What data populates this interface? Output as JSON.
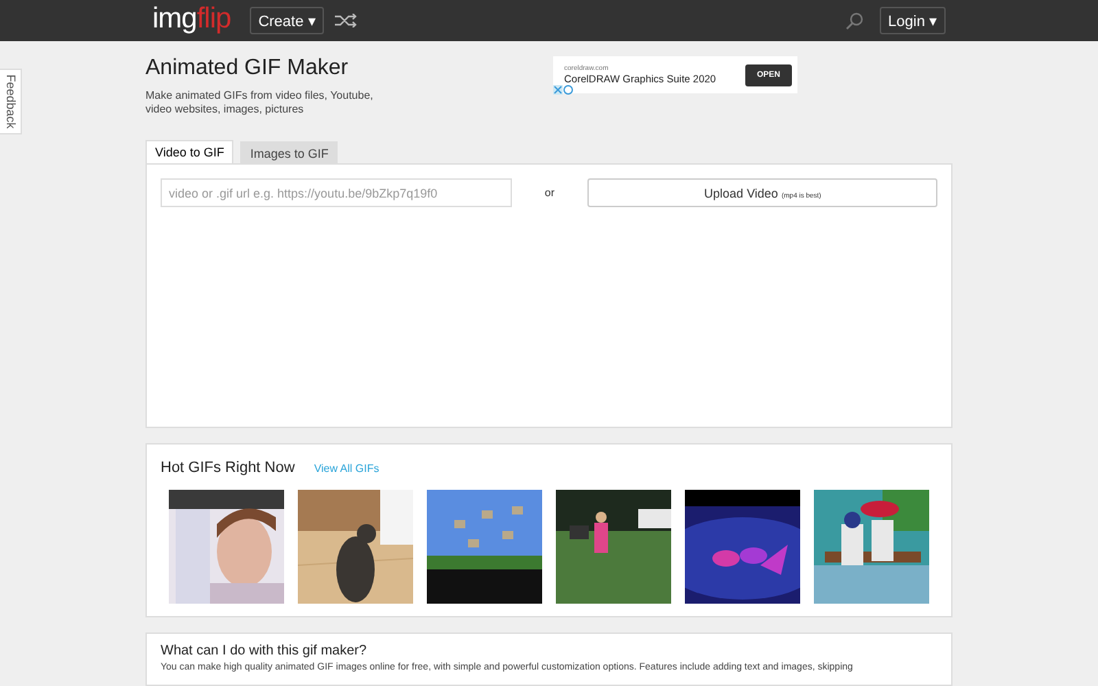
{
  "header": {
    "logo": {
      "first": "img",
      "second": "flip"
    },
    "create_button": "Create ▾",
    "login_button": "Login ▾"
  },
  "feedback_tab": "Feedback",
  "page": {
    "title": "Animated GIF Maker",
    "description": "Make animated GIFs from video files, Youtube, video websites, images, pictures"
  },
  "ad": {
    "domain": "coreldraw.com",
    "headline": "CorelDRAW Graphics Suite 2020",
    "button": "OPEN"
  },
  "tabs": [
    {
      "label": "Video to GIF",
      "selected": true
    },
    {
      "label": "Images to GIF",
      "selected": false
    }
  ],
  "video_form": {
    "url_placeholder": "video or .gif url e.g. https://youtu.be/9bZkp7q19f0",
    "or": "or",
    "upload_button": "Upload Video",
    "upload_hint": "(mp4 is best)"
  },
  "hot_gifs": {
    "title": "Hot GIFs Right Now",
    "link": "View All GIFs"
  },
  "faq": {
    "title": "What can I do with this gif maker?",
    "text": "You can make high quality animated GIF images online for free, with simple and powerful customization options. Features include adding text and images, skipping"
  }
}
